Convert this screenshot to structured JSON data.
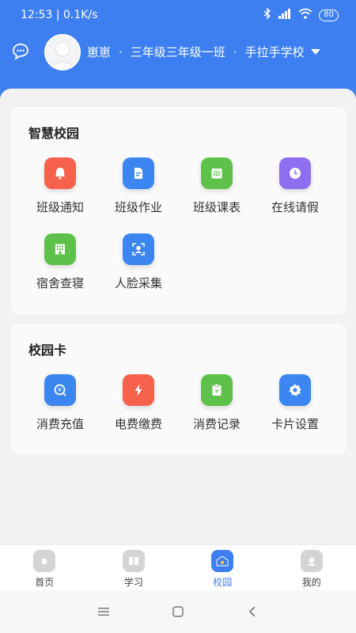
{
  "status": {
    "time": "12:53",
    "speed": "0.1K/s",
    "battery": "80"
  },
  "header": {
    "name": "崽崽",
    "grade": "三年级三年级一班",
    "school": "手拉手学校",
    "separator": "·"
  },
  "smart_campus": {
    "title": "智慧校园",
    "items": [
      {
        "label": "班级通知",
        "icon": "bell-icon",
        "color": "#f5614a"
      },
      {
        "label": "班级作业",
        "icon": "document-icon",
        "color": "#3b86f0"
      },
      {
        "label": "班级课表",
        "icon": "calendar-icon",
        "color": "#5ec24a"
      },
      {
        "label": "在线请假",
        "icon": "clock-icon",
        "color": "#8f6ef0"
      },
      {
        "label": "宿舍查寝",
        "icon": "building-icon",
        "color": "#5ec24a"
      },
      {
        "label": "人脸采集",
        "icon": "face-scan-icon",
        "color": "#3b86f0"
      }
    ]
  },
  "campus_card": {
    "title": "校园卡",
    "items": [
      {
        "label": "消费充值",
        "icon": "yen-search-icon",
        "color": "#3b86f0"
      },
      {
        "label": "电费缴费",
        "icon": "lightning-icon",
        "color": "#f5614a"
      },
      {
        "label": "消费记录",
        "icon": "receipt-icon",
        "color": "#5ec24a"
      },
      {
        "label": "卡片设置",
        "icon": "gear-icon",
        "color": "#3b86f0"
      }
    ]
  },
  "tabs": [
    {
      "label": "首页",
      "icon": "home-icon",
      "active": false
    },
    {
      "label": "学习",
      "icon": "book-icon",
      "active": false
    },
    {
      "label": "校园",
      "icon": "campus-icon",
      "active": true
    },
    {
      "label": "我的",
      "icon": "profile-icon",
      "active": false
    }
  ]
}
